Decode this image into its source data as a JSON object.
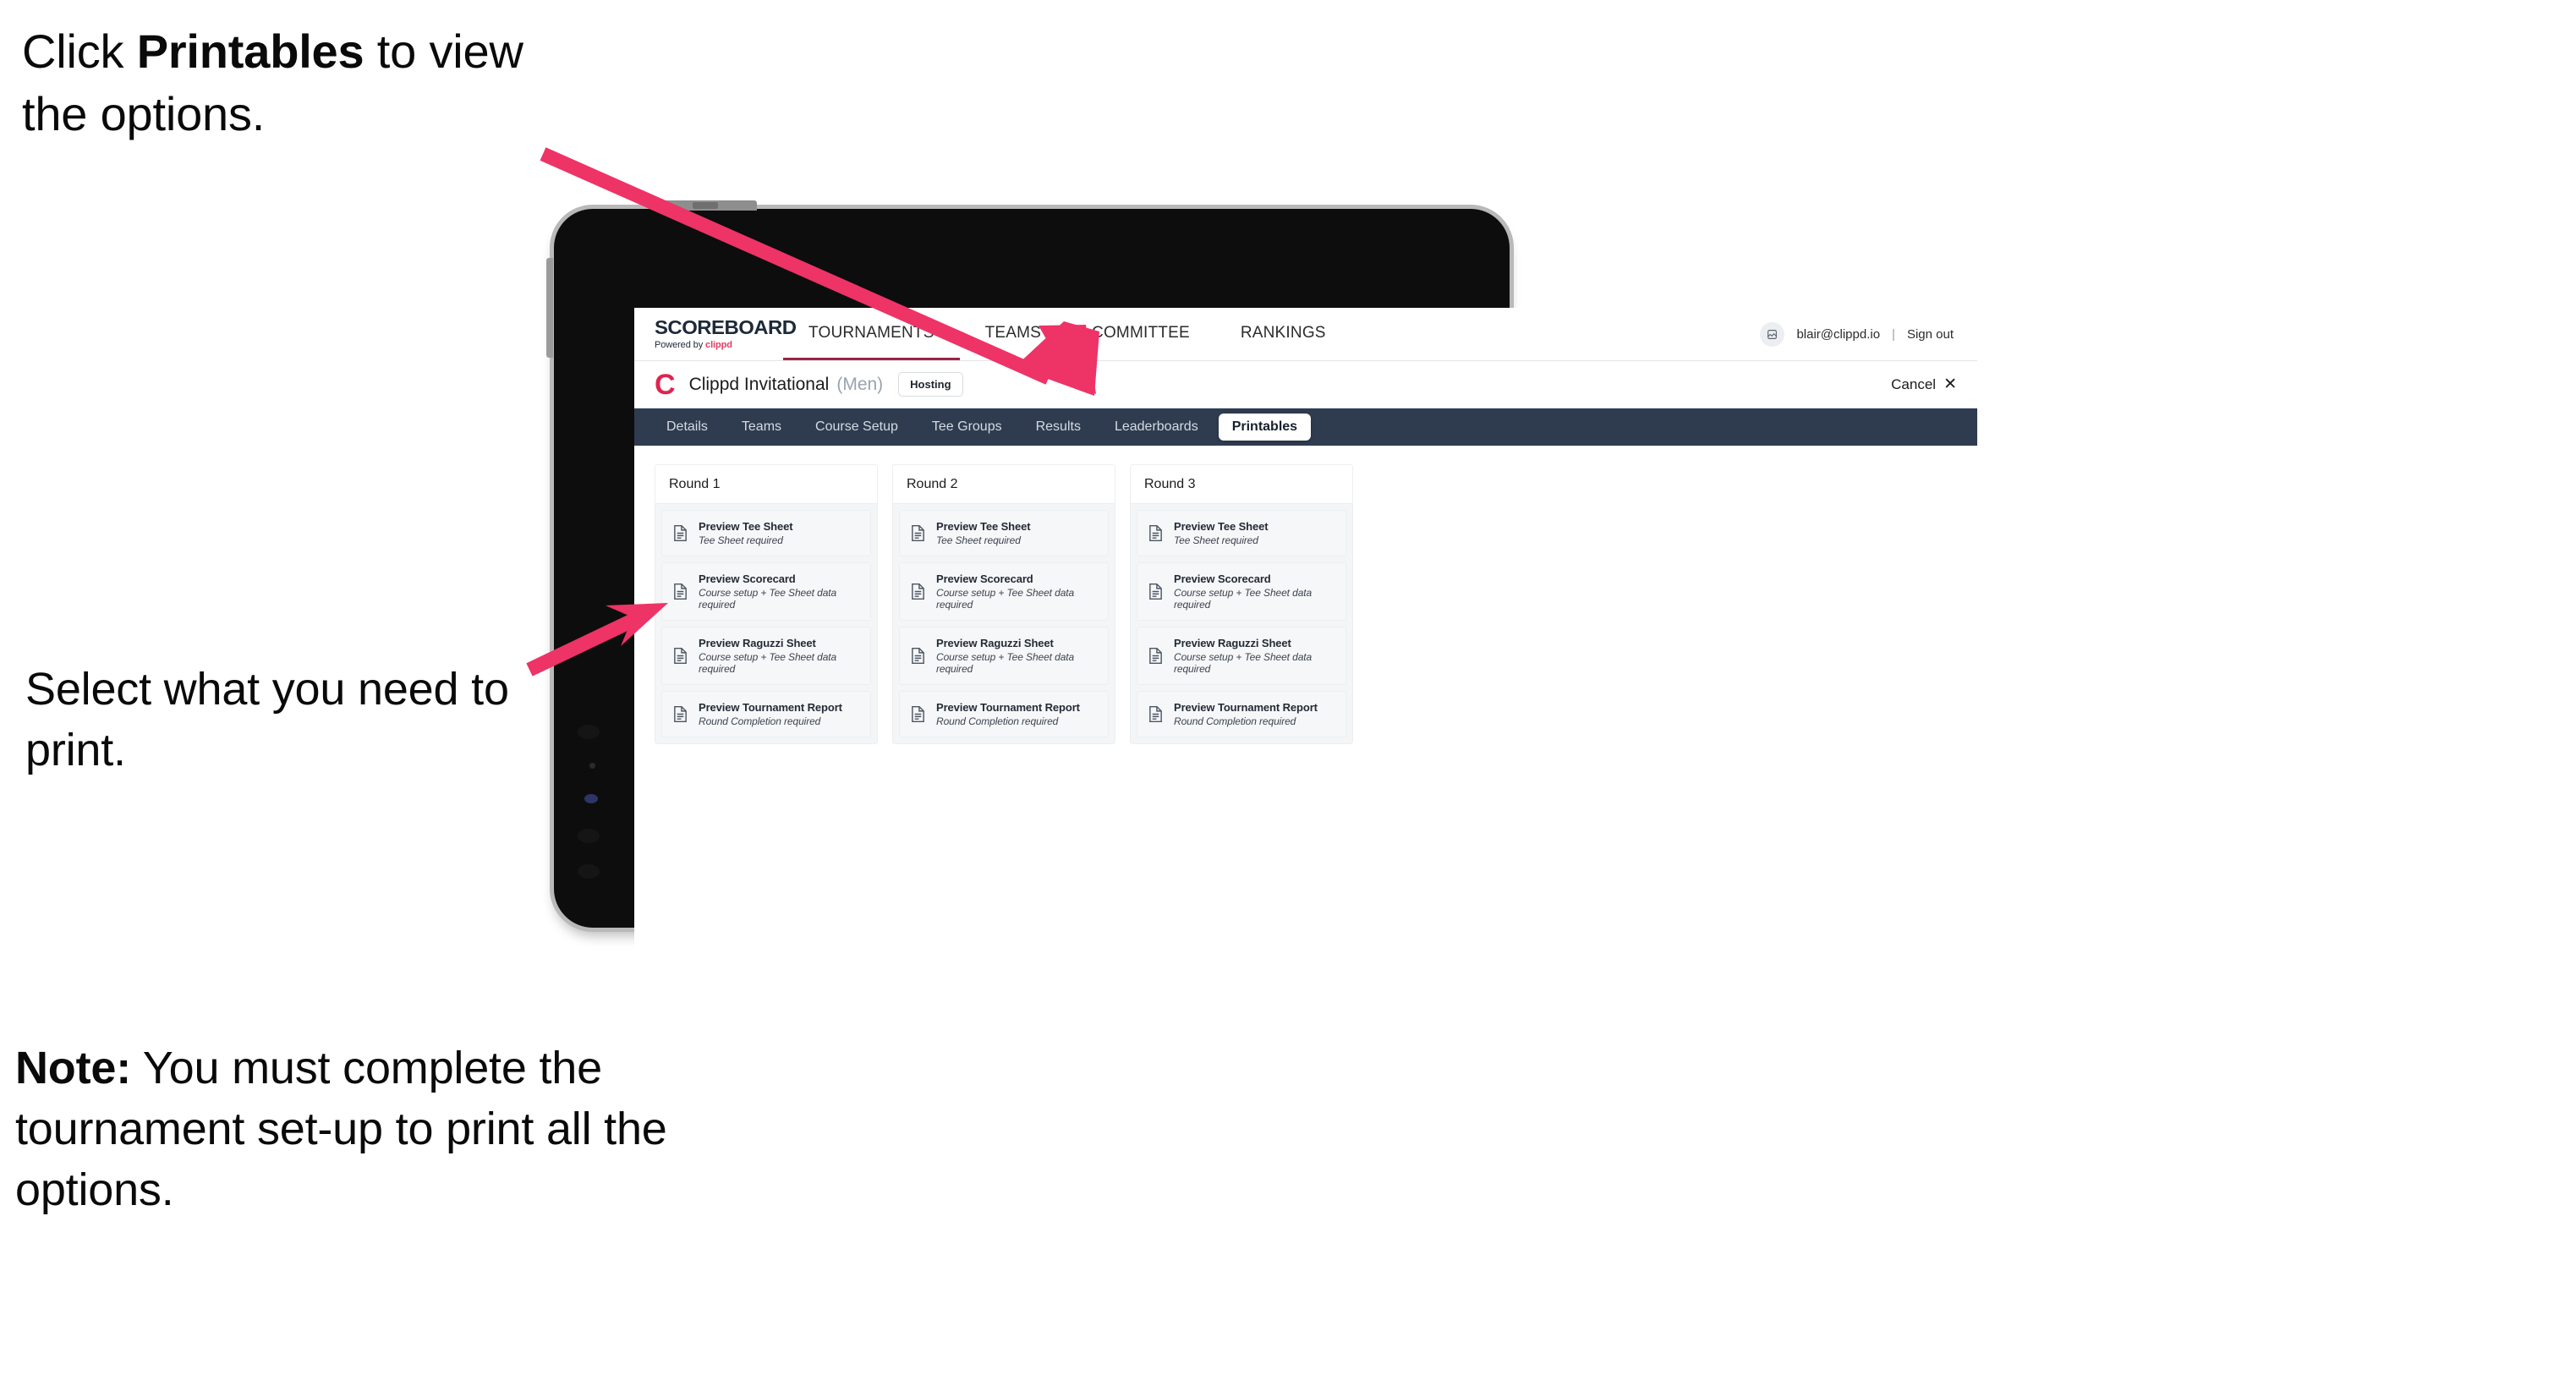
{
  "annotations": {
    "top": {
      "pre": "Click ",
      "bold": "Printables",
      "post": " to view the options."
    },
    "middle": {
      "text": "Select what you need to print."
    },
    "note": {
      "bold": "Note:",
      "text": " You must complete the tournament set-up to print all the options."
    }
  },
  "colors": {
    "accent_pink": "#ee3366",
    "brand_red": "#e0244f",
    "subnav_dark": "#2f3c50",
    "logo_navy": "#1e2a3a"
  },
  "app": {
    "logo": {
      "word": "SCOREBOARD",
      "powered_by": "Powered by ",
      "brand": "clippd"
    },
    "topnav": [
      {
        "label": "TOURNAMENTS",
        "active": true
      },
      {
        "label": "TEAMS",
        "active": false
      },
      {
        "label": "COMMITTEE",
        "active": false
      },
      {
        "label": "RANKINGS",
        "active": false
      }
    ],
    "account": {
      "avatar_icon": "user-avatar-icon",
      "email": "blair@clippd.io",
      "separator": "|",
      "sign_out": "Sign out"
    },
    "tournament_bar": {
      "logo_mark": "C",
      "name": "Clippd Invitational",
      "gender": "(Men)",
      "status_chip": "Hosting",
      "cancel_label": "Cancel",
      "cancel_icon": "✕"
    },
    "subnav": [
      {
        "label": "Details",
        "active": false
      },
      {
        "label": "Teams",
        "active": false
      },
      {
        "label": "Course Setup",
        "active": false
      },
      {
        "label": "Tee Groups",
        "active": false
      },
      {
        "label": "Results",
        "active": false
      },
      {
        "label": "Leaderboards",
        "active": false
      },
      {
        "label": "Printables",
        "active": true
      }
    ],
    "printables": {
      "rounds": [
        {
          "title": "Round 1",
          "items": [
            {
              "title": "Preview Tee Sheet",
              "requirement": "Tee Sheet required"
            },
            {
              "title": "Preview Scorecard",
              "requirement": "Course setup + Tee Sheet data required"
            },
            {
              "title": "Preview Raguzzi Sheet",
              "requirement": "Course setup + Tee Sheet data required"
            },
            {
              "title": "Preview Tournament Report",
              "requirement": "Round Completion required"
            }
          ]
        },
        {
          "title": "Round 2",
          "items": [
            {
              "title": "Preview Tee Sheet",
              "requirement": "Tee Sheet required"
            },
            {
              "title": "Preview Scorecard",
              "requirement": "Course setup + Tee Sheet data required"
            },
            {
              "title": "Preview Raguzzi Sheet",
              "requirement": "Course setup + Tee Sheet data required"
            },
            {
              "title": "Preview Tournament Report",
              "requirement": "Round Completion required"
            }
          ]
        },
        {
          "title": "Round 3",
          "items": [
            {
              "title": "Preview Tee Sheet",
              "requirement": "Tee Sheet required"
            },
            {
              "title": "Preview Scorecard",
              "requirement": "Course setup + Tee Sheet data required"
            },
            {
              "title": "Preview Raguzzi Sheet",
              "requirement": "Course setup + Tee Sheet data required"
            },
            {
              "title": "Preview Tournament Report",
              "requirement": "Round Completion required"
            }
          ]
        }
      ]
    }
  }
}
